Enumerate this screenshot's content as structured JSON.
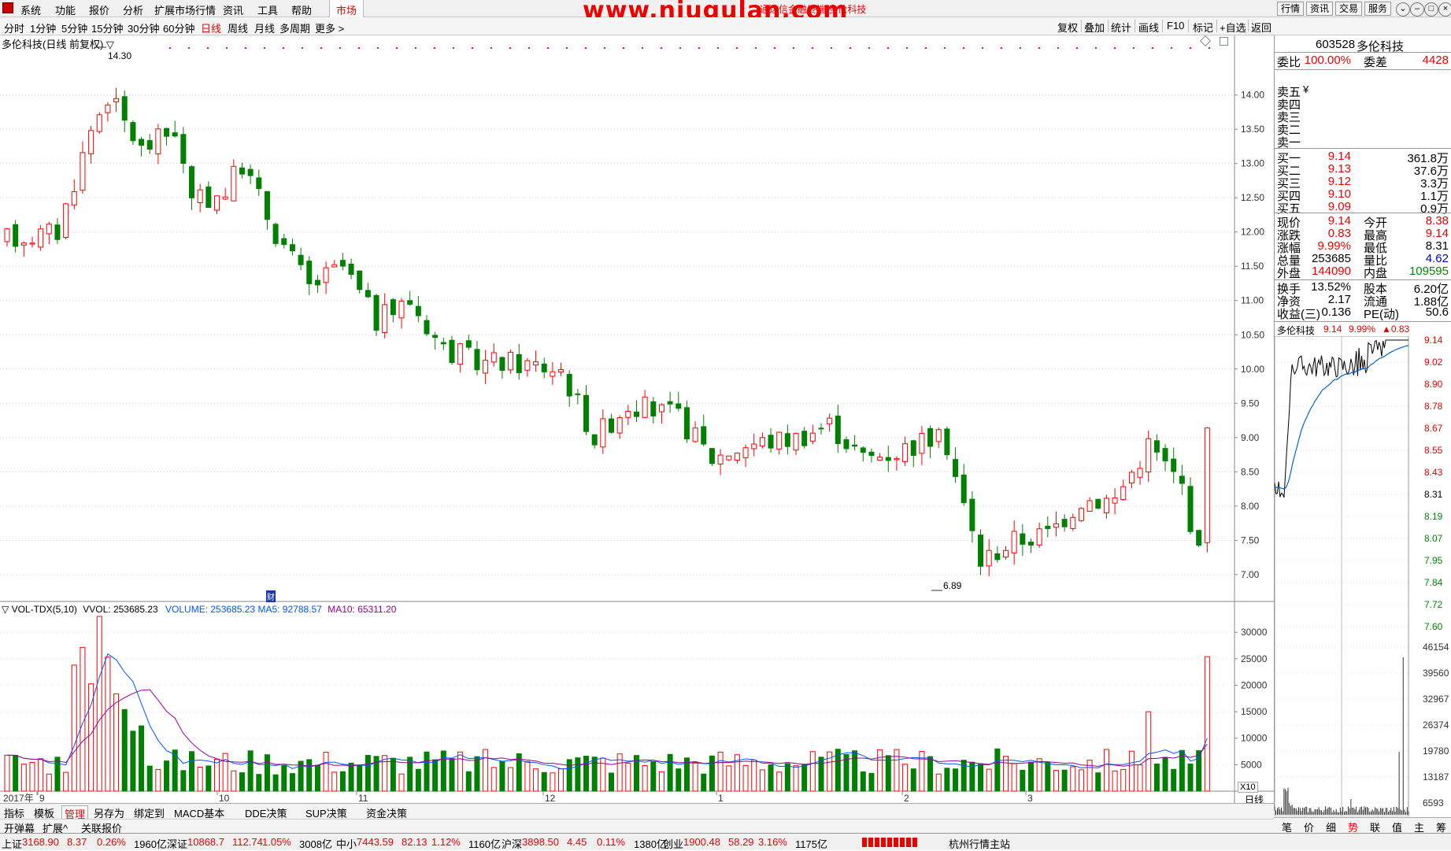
{
  "menu": {
    "items": [
      "系统",
      "功能",
      "报价",
      "分析",
      "扩展市场行情",
      "资讯",
      "工具",
      "帮助"
    ],
    "market_tab": "市场",
    "watermark": "www.niugulan.com",
    "title_ticker": "通达信金融终端  多伦科技",
    "right_tabs": [
      "行情",
      "资讯",
      "交易",
      "服务"
    ],
    "win_buttons": [
      "⌄",
      "–",
      "□",
      "×"
    ]
  },
  "periods": [
    "分时",
    "1分钟",
    "5分钟",
    "15分钟",
    "30分钟",
    "60分钟",
    "日线",
    "周线",
    "月线",
    "多周期",
    "更多 >"
  ],
  "active_period": "日线",
  "right_tools": [
    "复权",
    "叠加",
    "统计",
    "画线",
    "F10",
    "标记",
    "+自选",
    "返回"
  ],
  "chart": {
    "title": "多伦科技(日线 前复权) ▽",
    "high_label": "14.30",
    "low_label": "6.89",
    "y_ticks": [
      "14.00",
      "13.50",
      "13.00",
      "12.50",
      "12.00",
      "11.50",
      "11.00",
      "10.50",
      "10.00",
      "9.50",
      "9.00",
      "8.50",
      "8.00",
      "7.50",
      "7.00"
    ],
    "vol_header": {
      "name": "▽ VOL-TDX(5,10)",
      "vvol": "VVOL: 253685.23",
      "volume": "VOLUME: 253685.23",
      "ma5": "MA5: 92788.57",
      "ma10": "MA10: 65311.20"
    },
    "vol_ticks": [
      "30000",
      "25000",
      "20000",
      "15000",
      "10000",
      "5000"
    ],
    "vol_unit": "X10",
    "x_labels": [
      "2017年",
      "9",
      "10",
      "11",
      "12",
      "1",
      "2",
      "3"
    ],
    "cai_label": "财",
    "period_label": "日线",
    "colors": {
      "up": "#ff0000",
      "down": "#008000",
      "ma5": "#0055ff",
      "ma10": "#990099"
    }
  },
  "chart_data": {
    "type": "candlestick",
    "title": "多伦科技(日线 前复权)",
    "ylim": [
      6.7,
      14.8
    ],
    "high": 14.3,
    "low": 6.89,
    "last_volume": 253685.23,
    "ma5": 92788.57,
    "ma10": 65311.2
  },
  "quote": {
    "code": "603528",
    "name": "多伦科技",
    "weibi_label": "委比",
    "weibi": "100.00%",
    "weicha_label": "委差",
    "weicha": "4428",
    "sells": [
      {
        "label": "卖五",
        "price": "",
        "vol": ""
      },
      {
        "label": "卖四",
        "price": "",
        "vol": ""
      },
      {
        "label": "卖三",
        "price": "",
        "vol": ""
      },
      {
        "label": "卖二",
        "price": "",
        "vol": ""
      },
      {
        "label": "卖一",
        "price": "",
        "vol": ""
      }
    ],
    "buys": [
      {
        "label": "买一",
        "price": "9.14",
        "vol": "361.8万"
      },
      {
        "label": "买二",
        "price": "9.13",
        "vol": "37.6万"
      },
      {
        "label": "买三",
        "price": "9.12",
        "vol": "3.3万"
      },
      {
        "label": "买四",
        "price": "9.10",
        "vol": "1.1万"
      },
      {
        "label": "买五",
        "price": "9.09",
        "vol": "0.9万"
      }
    ],
    "stats": [
      {
        "l1": "现价",
        "v1": "9.14",
        "c1": "red",
        "l2": "今开",
        "v2": "8.38",
        "c2": "red"
      },
      {
        "l1": "涨跌",
        "v1": "0.83",
        "c1": "red",
        "l2": "最高",
        "v2": "9.14",
        "c2": "red"
      },
      {
        "l1": "涨幅",
        "v1": "9.99%",
        "c1": "red",
        "l2": "最低",
        "v2": "8.31",
        "c2": ""
      },
      {
        "l1": "总量",
        "v1": "253685",
        "c1": "",
        "l2": "量比",
        "v2": "4.62",
        "c2": "blue"
      },
      {
        "l1": "外盘",
        "v1": "144090",
        "c1": "red",
        "l2": "内盘",
        "v2": "109595",
        "c2": "green"
      }
    ],
    "stats2": [
      {
        "l1": "换手",
        "v1": "13.52%",
        "l2": "股本",
        "v2": "6.20亿"
      },
      {
        "l1": "净资",
        "v1": "2.17",
        "l2": "流通",
        "v2": "1.88亿"
      },
      {
        "l1": "收益(三)",
        "v1": "0.136",
        "l2": "PE(动)",
        "v2": "50.6"
      }
    ],
    "mini": {
      "name": "多伦科技",
      "price": "9.14",
      "pct": "9.99%",
      "chg": "▲0.83",
      "ticks": [
        "9.14",
        "9.02",
        "8.90",
        "8.78",
        "8.67",
        "8.55",
        "8.43",
        "8.31",
        "8.19",
        "8.07",
        "7.95",
        "7.84",
        "7.72",
        "7.60"
      ],
      "vol_ticks": [
        "46154",
        "39560",
        "32967",
        "26374",
        "19780",
        "13187",
        "6593"
      ]
    },
    "mini_tabs": [
      "笔",
      "价",
      "细",
      "势",
      "联",
      "值",
      "主",
      "筹"
    ]
  },
  "bottom_tabs": [
    "指标",
    "模板",
    "管理",
    "另存为",
    "绑定到",
    "MACD基本",
    "DDE决策",
    "SUP决策",
    "资金决策"
  ],
  "bottom_tabs2": [
    "开弹幕",
    "扩展^",
    "关联报价"
  ],
  "status": [
    {
      "name": "上证",
      "val": "3168.90",
      "chg": "8.37",
      "pct": "0.26%",
      "amt": "1960亿"
    },
    {
      "name": "深证",
      "val": "10868.7",
      "chg": "112.74",
      "pct": "1.05%",
      "amt": "3008亿"
    },
    {
      "name": "中小",
      "val": "7443.59",
      "chg": "82.13",
      "pct": "1.12%",
      "amt": "1160亿"
    },
    {
      "name": "沪深",
      "val": "3898.50",
      "chg": "4.45",
      "pct": "0.11%",
      "amt": "1380亿"
    },
    {
      "name": "创业",
      "val": "1900.48",
      "chg": "58.29",
      "pct": "3.16%",
      "amt": "1175亿"
    }
  ],
  "status_station": "杭州行情主站"
}
